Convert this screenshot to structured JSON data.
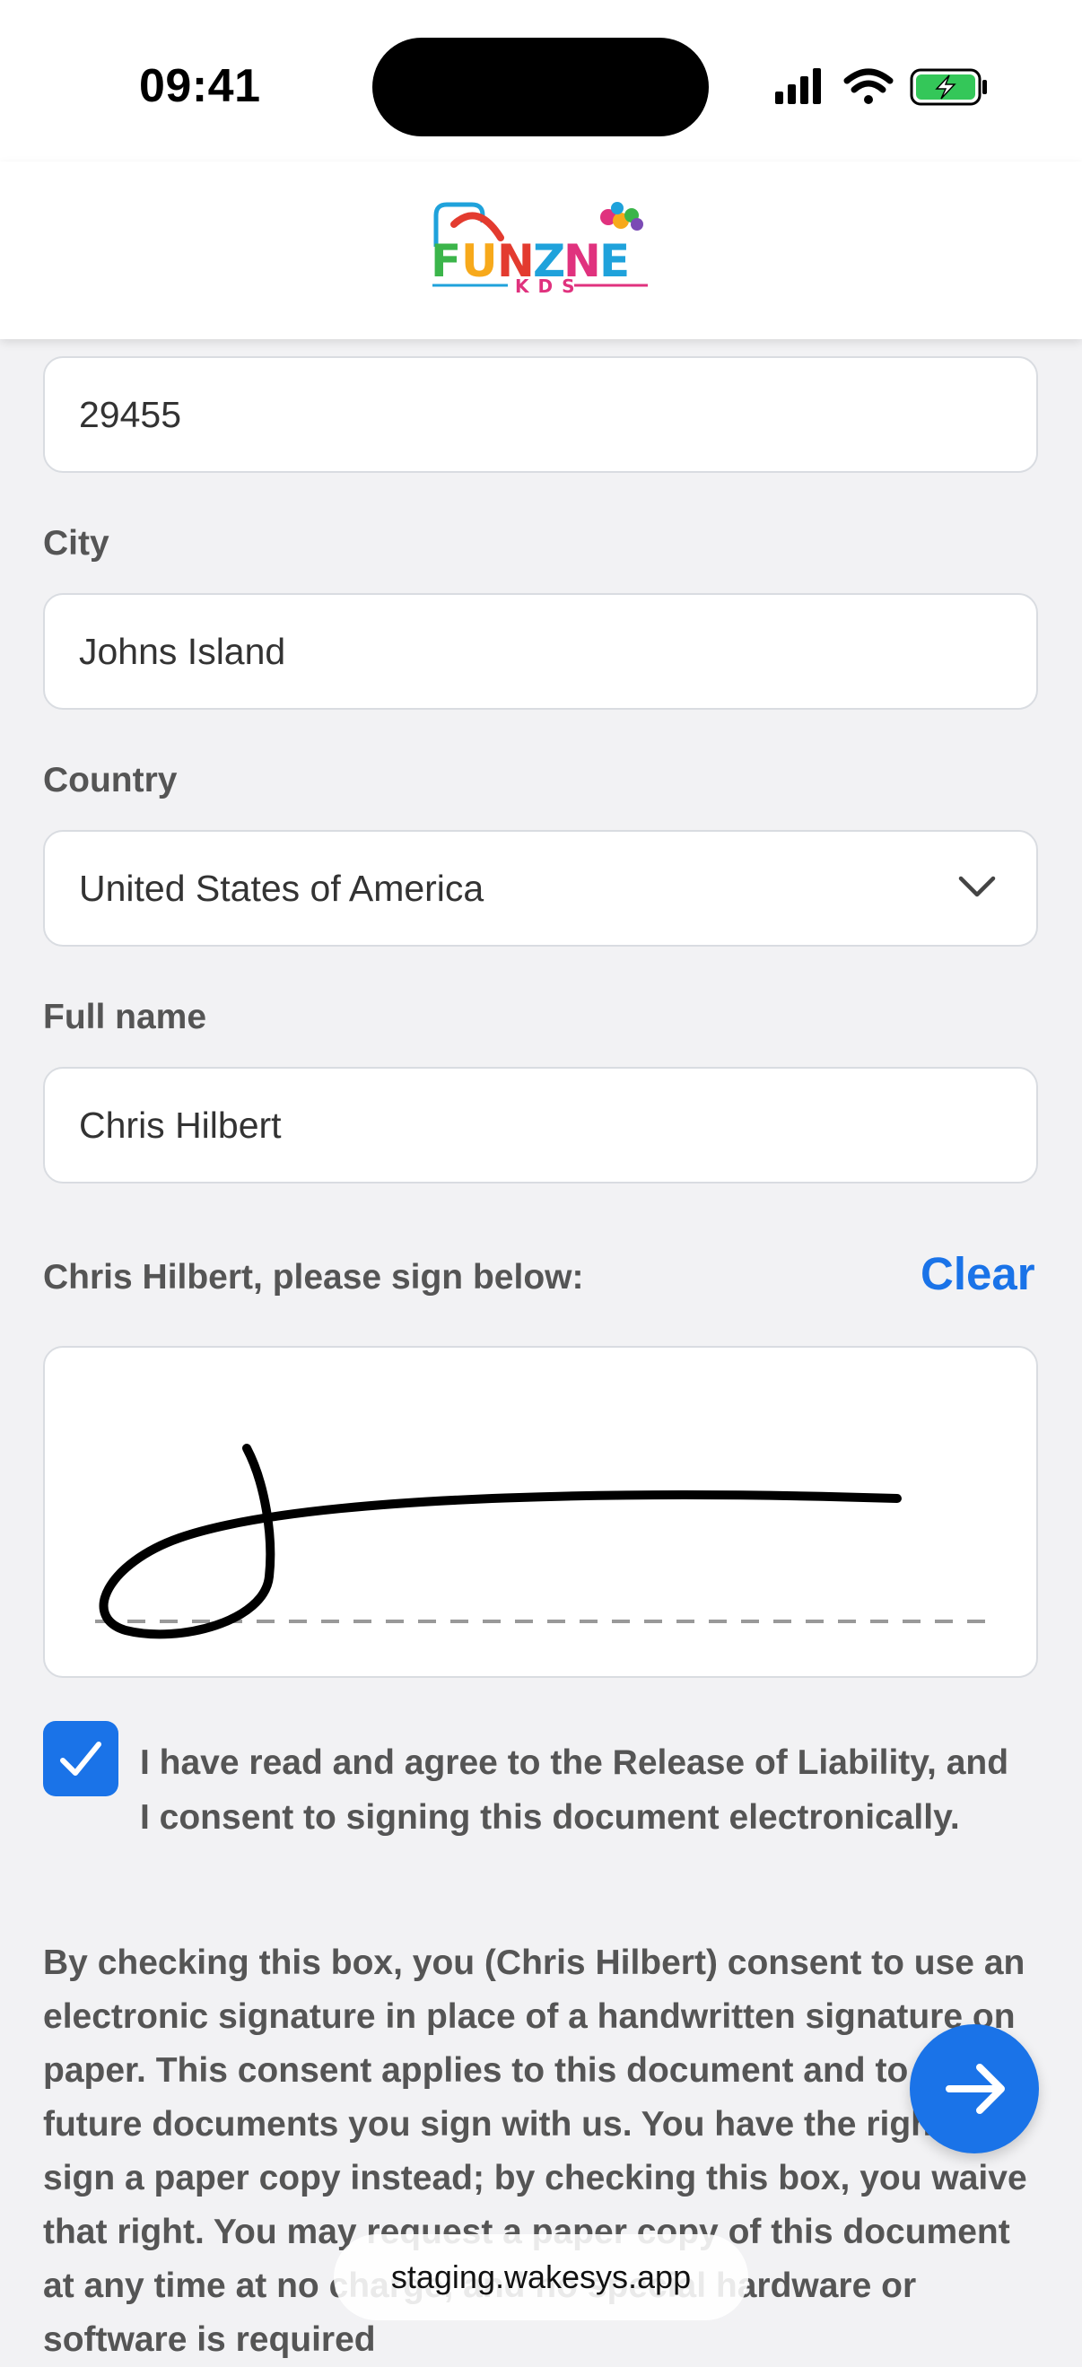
{
  "status_bar": {
    "time": "09:41",
    "icons": [
      "cellular-signal-icon",
      "wifi-icon",
      "battery-charging-icon"
    ]
  },
  "header": {
    "logo_text": "FUNZNE",
    "logo_subtext": "KDS",
    "logo_colors": [
      "#e33b2f",
      "#1fa2db",
      "#f7a91b",
      "#3bb54a",
      "#e0327e"
    ]
  },
  "form": {
    "zip": {
      "value": "29455"
    },
    "city": {
      "label": "City",
      "value": "Johns Island"
    },
    "country": {
      "label": "Country",
      "value": "United States of America"
    },
    "full_name": {
      "label": "Full name",
      "value": "Chris Hilbert"
    },
    "signature": {
      "prompt": "Chris Hilbert, please sign below:",
      "clear_label": "Clear"
    },
    "agreement": {
      "checked": true,
      "text": "I have read and agree to the Release of Liability, and I consent to signing this document electronically."
    },
    "consent_text": "By checking this box, you (Chris Hilbert) consent to use an electronic signature in place of a handwritten signature on paper. This consent applies to this document and to any future documents you sign with us. You have the right to sign a paper copy instead; by checking this box, you waive that right. You may request a paper copy of this document at any time at no charge, and no special hardware or software is required"
  },
  "browser": {
    "url": "staging.wakesys.app"
  },
  "colors": {
    "accent": "#1a73e8",
    "label": "#555555",
    "border": "#d9dce1"
  }
}
